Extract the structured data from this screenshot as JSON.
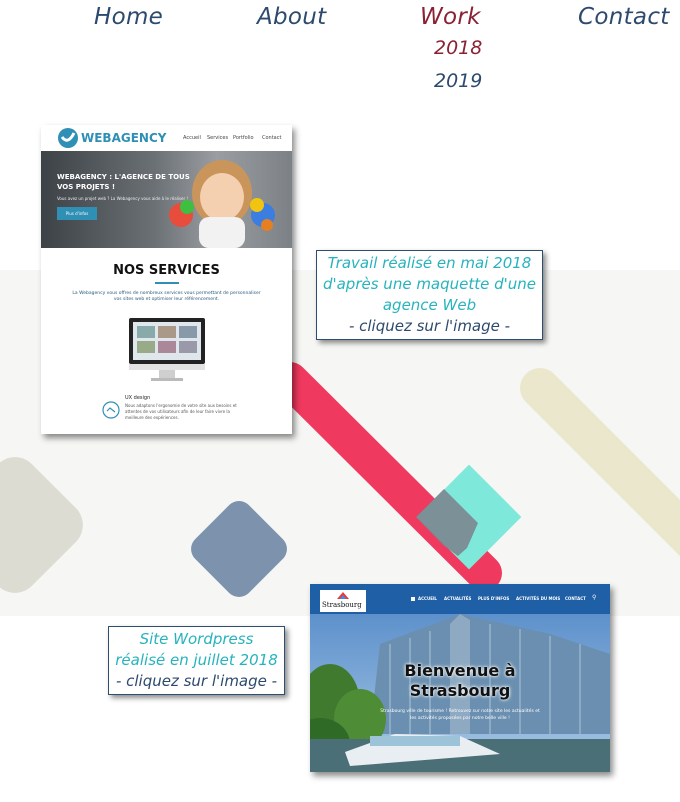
{
  "nav": {
    "home": "Home",
    "about": "About",
    "work": "Work",
    "contact": "Contact",
    "years": [
      "2018",
      "2019"
    ]
  },
  "colors": {
    "nav_text": "#2d4a6e",
    "active": "#8a2233",
    "caption_teal": "#27b3bd",
    "pink_bar": "#f0395e",
    "turquoise": "#7ee8da",
    "slate_diamond": "#7d93ad",
    "beige": "#ebe7cc",
    "grey_diamond": "#dcdcd2"
  },
  "project1": {
    "brand": "WEBAGENCY",
    "menu": [
      "Accueil",
      "Services",
      "Portfolio",
      "Contact"
    ],
    "hero_title_1": "WEBAGENCY : L'AGENCE DE TOUS",
    "hero_title_2": "VOS PROJETS !",
    "hero_sub": "Vous avez un projet web ? La Webagency vous aide à le réaliser !",
    "hero_button": "Plus d'infos",
    "section_title": "NOS SERVICES",
    "section_text": "La Webagency vous offres de nombreux services vous permettant de personnaliser vos sites web et optimiser leur référencement.",
    "ux_title": "UX design",
    "ux_text": "Nous adaptons l'ergonomie de votre site aux besoins et attentes de vos utilisateurs afin de leur faire vivre la meilleure des expériences.",
    "caption_line1": "Travail réalisé en mai 2018",
    "caption_line2": "d'après une maquette d'une",
    "caption_line3": "agence Web",
    "caption_line4": "- cliquez sur l'image -"
  },
  "project2": {
    "logo": "Strasbourg",
    "menu": [
      "ACCUEIL",
      "ACTUALITÉS",
      "PLUS D'INFOS",
      "ACTIVITÉS DU MOIS",
      "CONTACT"
    ],
    "hero_title_1": "Bienvenue à",
    "hero_title_2": "Strasbourg",
    "hero_sub_1": "Strasbourg ville de tourisme ! Retrouvez sur notre site les actualités et",
    "hero_sub_2": "les activités proposées par notre belle ville !",
    "caption_line1": "Site Wordpress",
    "caption_line2": "réalisé en juillet 2018",
    "caption_line3": "- cliquez sur l'image -"
  }
}
